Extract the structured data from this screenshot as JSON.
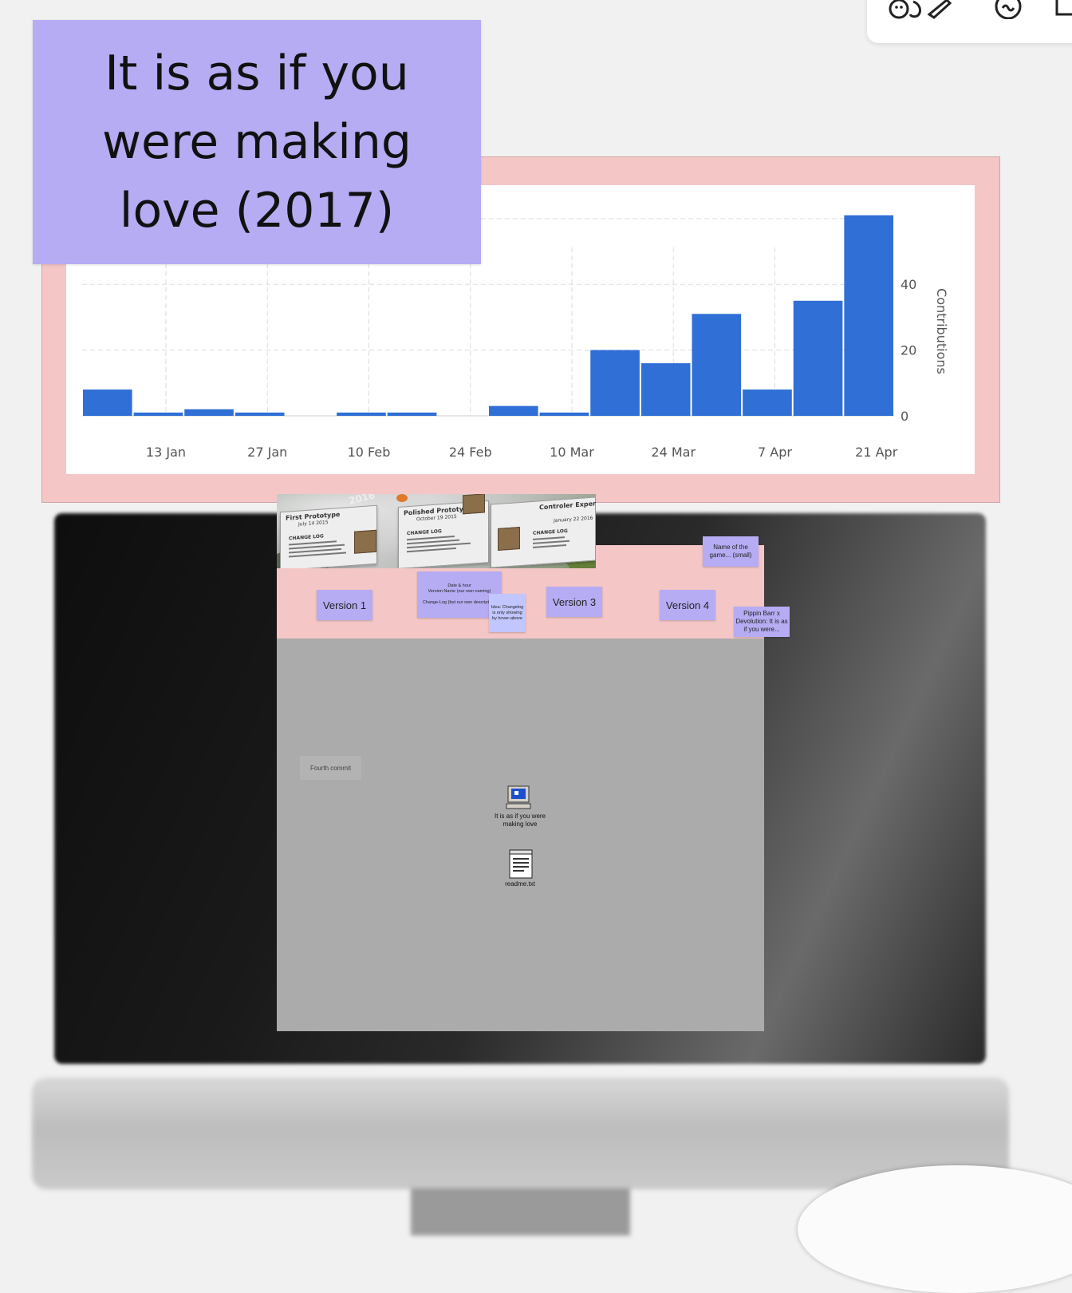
{
  "title_note": {
    "text": "It is as if you were making love (2017)"
  },
  "chart_data": {
    "type": "bar",
    "xlabel": "",
    "ylabel": "Contributions",
    "x_ticks": [
      "13 Jan",
      "27 Jan",
      "10 Feb",
      "24 Feb",
      "10 Mar",
      "24 Mar",
      "7 Apr",
      "21 Apr"
    ],
    "y_ticks": [
      "0",
      "20",
      "40"
    ],
    "ylim": [
      0,
      60
    ],
    "grid": true,
    "bar_color": "#2f6fd6",
    "values": [
      8,
      1,
      2,
      1,
      0,
      1,
      1,
      0,
      3,
      1,
      20,
      16,
      31,
      8,
      35,
      61
    ]
  },
  "banner": {
    "cards": [
      {
        "title": "First Prototype",
        "date": "July 14 2015",
        "heading": "CHANGE LOG"
      },
      {
        "title": "Polished Prototype",
        "date": "October 19 2015",
        "heading": "CHANGE LOG"
      },
      {
        "title": "Controler Experimentation",
        "date": "January 22 2016",
        "heading": "CHANGE LOG"
      }
    ],
    "year": "2016"
  },
  "versions": [
    "Version 1",
    "Version 3",
    "Version 4"
  ],
  "notes": {
    "date_hour": "Date & hour\nVersion Name (our own naming)\n\nChange-Log (but our own description)",
    "idea": "Idea: Changelog is only showing by hover-above",
    "name_small": "Name of the game... (small)",
    "pippin": "Pippin Barr x Devolution: It is as if you were..."
  },
  "desktop": {
    "fourth_commit": "Fourth commit",
    "icons": [
      {
        "label": "It is as if you were making love",
        "icon": "computer-icon"
      },
      {
        "label": "readme.txt",
        "icon": "notepad-icon"
      }
    ]
  },
  "colors": {
    "sticky_purple": "#b6acf3",
    "pink_frame": "#f4c6c6",
    "bar_blue": "#2f6fd6",
    "desktop_gray": "#ababab"
  }
}
